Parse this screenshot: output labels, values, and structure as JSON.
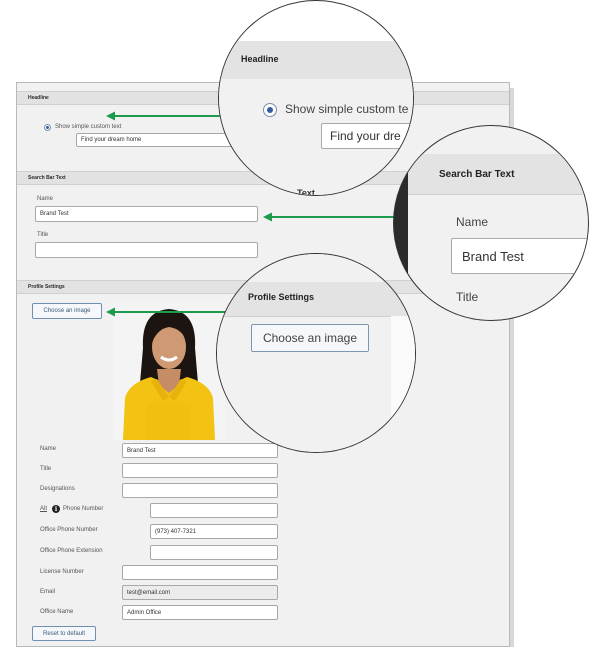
{
  "headline": {
    "section_title": "Headline",
    "radio_label": "Show simple custom text",
    "input_value": "Find your dream home"
  },
  "search_bar": {
    "section_title": "Search Bar Text",
    "name_label": "Name",
    "name_value": "Brand Test",
    "title_label": "Title",
    "title_value": ""
  },
  "profile": {
    "section_title": "Profile Settings",
    "choose_image_label": "Choose an image",
    "reset_label": "Reset to default",
    "fields": [
      {
        "label": "Name",
        "value": "Brand Test"
      },
      {
        "label": "Title",
        "value": ""
      },
      {
        "label": "Designations",
        "value": ""
      },
      {
        "label": "Alt",
        "value": ""
      },
      {
        "label": "Office Phone Number",
        "value": "(973) 407-7321"
      },
      {
        "label": "Office Phone Extension",
        "value": ""
      },
      {
        "label": "License Number",
        "value": ""
      },
      {
        "label": "Email",
        "value": "test@email.com"
      },
      {
        "label": "Office Name",
        "value": "Admin Office"
      }
    ],
    "alt_phone_label": "Phone Number",
    "info_icon_glyph": "i"
  },
  "zoom1": {
    "title": "Headline",
    "radio_label": "Show simple custom te",
    "input_value": "Find your dre",
    "peek_text": "Text"
  },
  "zoom2": {
    "title": "Search Bar Text",
    "name_label": "Name",
    "name_value": "Brand Test",
    "title_label": "Title"
  },
  "zoom3": {
    "title": "Profile Settings",
    "button_label": "Choose an image"
  },
  "colors": {
    "arrow": "#1e9a4d",
    "photo_shirt": "#f2c313",
    "link_blue": "#2f5fa0"
  },
  "icons": [
    "radio-selected-icon",
    "info-icon",
    "arrow-left-icon"
  ]
}
